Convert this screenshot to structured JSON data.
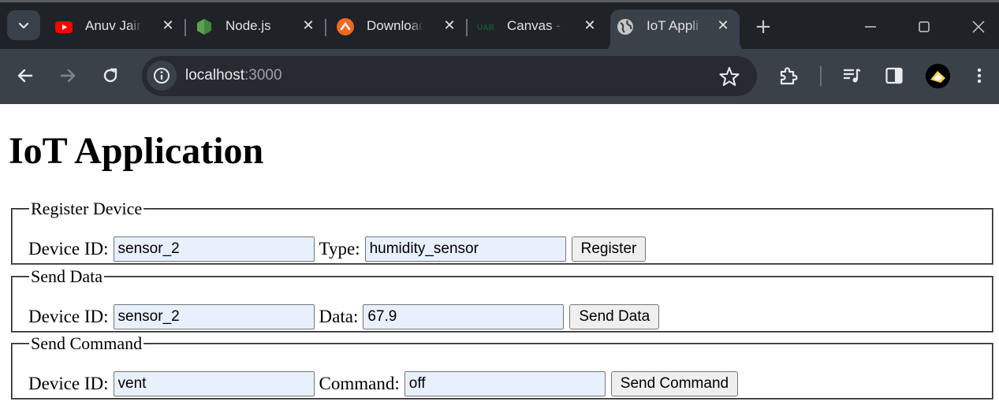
{
  "browser": {
    "tabs": [
      {
        "title": "Anuv Jain",
        "icon": "youtube-icon"
      },
      {
        "title": "Node.js",
        "icon": "nodejs-icon"
      },
      {
        "title": "Download",
        "icon": "download-site-icon"
      },
      {
        "title": "Canvas -",
        "icon": "canvas-icon"
      },
      {
        "title": "IoT Appli",
        "icon": "globe-icon",
        "active": true
      }
    ],
    "url_host": "localhost",
    "url_port": ":3000"
  },
  "page": {
    "title": "IoT Application",
    "register": {
      "legend": "Register Device",
      "device_id_label": "Device ID:",
      "device_id_value": "sensor_2",
      "type_label": "Type:",
      "type_value": "humidity_sensor",
      "button": "Register"
    },
    "send_data": {
      "legend": "Send Data",
      "device_id_label": "Device ID:",
      "device_id_value": "sensor_2",
      "data_label": "Data:",
      "data_value": "67.9",
      "button": "Send Data"
    },
    "send_command": {
      "legend": "Send Command",
      "device_id_label": "Device ID:",
      "device_id_value": "vent",
      "command_label": "Command:",
      "command_value": "off",
      "button": "Send Command"
    }
  },
  "colors": {
    "tabbar_bg": "#1f2227",
    "toolbar_bg": "#3a4149",
    "autofill_bg": "#e8f0fe"
  }
}
